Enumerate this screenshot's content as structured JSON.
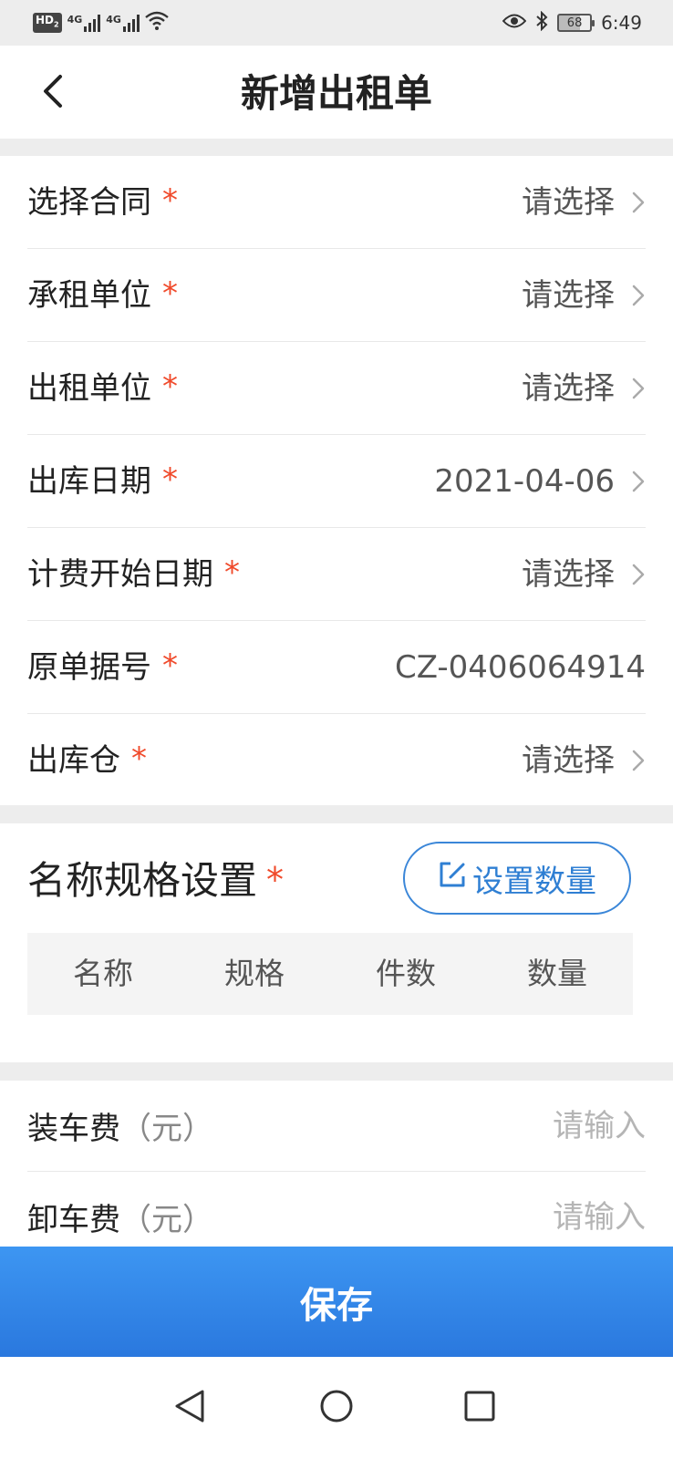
{
  "status_bar": {
    "hd_label": "HD",
    "hd_sub": "2",
    "net1": "4G",
    "net2": "4G",
    "battery": "68",
    "time": "6:49"
  },
  "header": {
    "title": "新增出租单",
    "back_icon": "chevron-left-icon"
  },
  "form": {
    "rows": [
      {
        "label": "选择合同",
        "required": "*",
        "value": "请选择"
      },
      {
        "label": "承租单位",
        "required": "*",
        "value": "请选择"
      },
      {
        "label": "出租单位",
        "required": "*",
        "value": "请选择"
      },
      {
        "label": "出库日期",
        "required": "*",
        "value": "2021-04-06"
      },
      {
        "label": "计费开始日期",
        "required": "*",
        "value": "请选择"
      },
      {
        "label": "原单据号",
        "required": "*",
        "value": "CZ-0406064914"
      },
      {
        "label": "出库仓",
        "required": "*",
        "value": "请选择"
      }
    ]
  },
  "spec": {
    "title": "名称规格设置",
    "required": "*",
    "set_button": "设置数量",
    "columns": [
      "名称",
      "规格",
      "件数",
      "数量"
    ]
  },
  "fees": [
    {
      "label": "装车费",
      "unit": "（元）",
      "value": "",
      "placeholder": "请输入"
    },
    {
      "label": "卸车费",
      "unit": "（元）",
      "value": "",
      "placeholder": "请输入"
    }
  ],
  "save_button": "保存",
  "colors": {
    "accent": "#2f7fd3",
    "required": "#f04a2b",
    "save_top": "#3d96f2",
    "save_bottom": "#2a78de"
  }
}
